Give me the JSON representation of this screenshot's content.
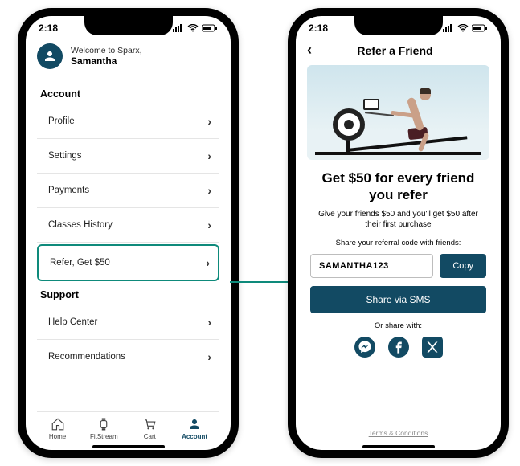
{
  "status": {
    "time": "2:18"
  },
  "left": {
    "welcome_prefix": "Welcome to Sparx,",
    "welcome_name": "Samantha",
    "sections": {
      "account_header": "Account",
      "support_header": "Support"
    },
    "account_items": [
      {
        "label": "Profile"
      },
      {
        "label": "Settings"
      },
      {
        "label": "Payments"
      },
      {
        "label": "Classes History"
      },
      {
        "label": "Refer, Get $50"
      }
    ],
    "support_items": [
      {
        "label": "Help Center"
      },
      {
        "label": "Recommendations"
      }
    ],
    "nav": [
      {
        "label": "Home"
      },
      {
        "label": "FitStream"
      },
      {
        "label": "Cart"
      },
      {
        "label": "Account"
      }
    ]
  },
  "right": {
    "header": "Refer a Friend",
    "title": "Get $50 for every friend you refer",
    "subtitle": "Give your friends $50 and you'll get $50 after their first purchase",
    "share_label": "Share your referral code with friends:",
    "code": "SAMANTHA123",
    "copy_label": "Copy",
    "sms_label": "Share via SMS",
    "or_share": "Or share with:",
    "terms": "Terms & Conditions"
  },
  "colors": {
    "accent": "#0e8a7b",
    "brand": "#124a63"
  }
}
